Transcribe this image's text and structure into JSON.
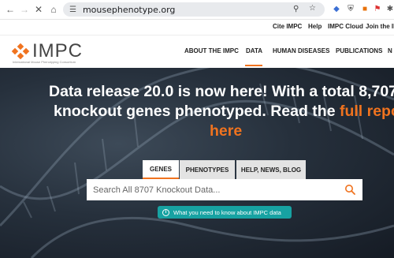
{
  "browser": {
    "url": "mousephenotype.org"
  },
  "topbar": {
    "links": [
      "Cite IMPC",
      "Help",
      "IMPC Cloud",
      "Join the IMPC"
    ]
  },
  "logo": {
    "name": "IMPC",
    "subtitle": "International Mouse Phenotyping Consortium"
  },
  "nav": {
    "items": [
      "ABOUT THE IMPC",
      "DATA",
      "HUMAN DISEASES",
      "PUBLICATIONS",
      "N"
    ],
    "active": "DATA"
  },
  "hero": {
    "line1": "Data release 20.0 is now here! With a total 8,707",
    "line2_pre": "knockout genes phenotyped. Read the ",
    "line2_link": "full report",
    "line3_link": "here"
  },
  "search": {
    "tabs": [
      "GENES",
      "PHENOTYPES",
      "HELP, NEWS, BLOG"
    ],
    "active_tab": "GENES",
    "placeholder": "Search All 8707 Knockout Data...",
    "info_button": "What you need to know about IMPC data"
  },
  "colors": {
    "accent": "#f0731f",
    "teal": "#17a2a2"
  }
}
